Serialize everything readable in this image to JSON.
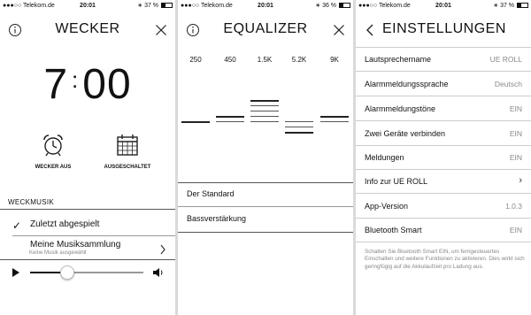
{
  "status": {
    "carrier": "●●●○○ Telekom.de",
    "time": "20:01",
    "battery_s1": "37 %",
    "battery_s2": "36 %",
    "battery_s3": "37 %",
    "battery_level_s1": 0.37,
    "battery_level_s2": 0.36,
    "battery_level_s3": 0.37
  },
  "wecker": {
    "title": "WECKER",
    "hours": "7",
    "colon": ":",
    "minutes": "00",
    "alarm_button": "WECKER AUS",
    "schedule_button": "AUSGESCHALTET",
    "section": "WECKMUSIK",
    "option_selected": "Zuletzt abgespielt",
    "check": "✓",
    "option_library": "Meine Musiksammlung",
    "option_library_sub": "Keine Musik ausgewählt",
    "volume_level": 0.33
  },
  "equalizer": {
    "title": "EQUALIZER",
    "bands": [
      "250",
      "450",
      "1.5K",
      "5.2K",
      "9K"
    ],
    "levels": [
      0,
      2,
      5,
      -3,
      2
    ],
    "presets": [
      "Der Standard",
      "Bassverstärkung"
    ]
  },
  "einstellungen": {
    "title": "EINSTELLUNGEN",
    "rows": [
      {
        "label": "Lautsprechername",
        "value": "UE ROLL"
      },
      {
        "label": "Alarmmeldungssprache",
        "value": "Deutsch"
      },
      {
        "label": "Alarmmeldungstöne",
        "value": "EIN"
      },
      {
        "label": "Zwei Geräte verbinden",
        "value": "EIN"
      },
      {
        "label": "Meldungen",
        "value": "EIN"
      },
      {
        "label": "Info zur UE ROLL",
        "value": "›"
      },
      {
        "label": "App-Version",
        "value": "1.0.3"
      },
      {
        "label": "Bluetooth Smart",
        "value": "EIN"
      }
    ],
    "footnote": "Schalten Sie Bluetooth Smart EIN, um ferngesteuertes Einschalten und weitere Funktionen zu aktivieren. Dies wirkt sich geringfügig auf die Akkulaufzeit pro Ladung aus."
  },
  "colors": {
    "text": "#111111",
    "muted": "#8a8a8a",
    "divider": "#cccccc"
  },
  "icons": [
    "info-icon",
    "close-icon",
    "alarm-clock-icon",
    "calendar-icon",
    "play-icon",
    "speaker-icon",
    "chevron-right-icon",
    "back-chevron-icon"
  ]
}
